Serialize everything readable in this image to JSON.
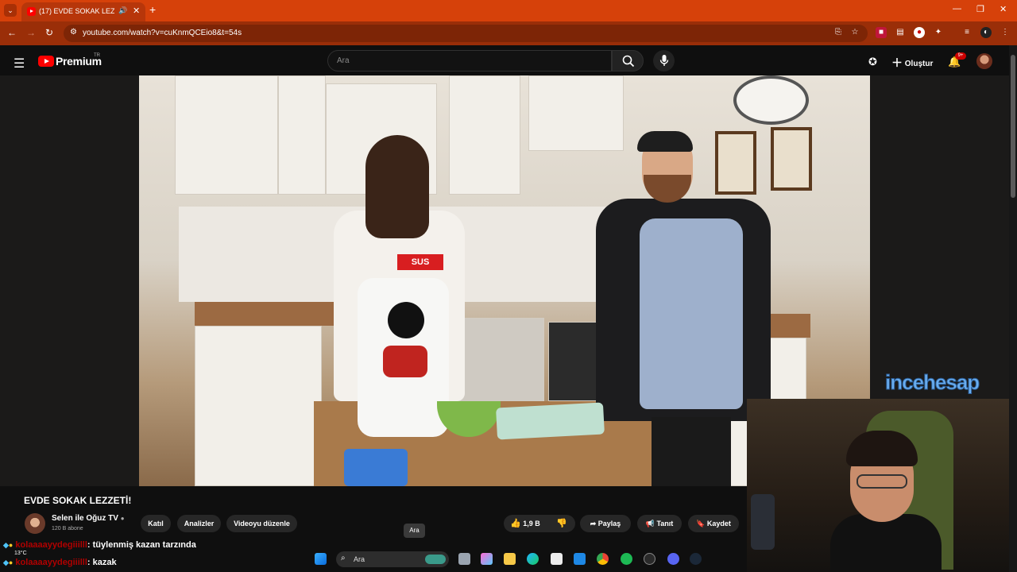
{
  "browser": {
    "tab_title": "(17) EVDE SOKAK LEZZETİ!",
    "url": "youtube.com/watch?v=cuKnmQCEio8&t=54s"
  },
  "youtube": {
    "logo_text": "Premium",
    "logo_region": "TR",
    "search_placeholder": "Ara",
    "create_label": "Oluştur",
    "notif_badge": "9+"
  },
  "video": {
    "title": "EVDE SOKAK LEZZETİ!",
    "apron_text": "SUS",
    "watermark": "incehesap"
  },
  "channel": {
    "name": "Selen ile Oğuz TV",
    "subs": "120 B abone"
  },
  "actions": {
    "join": "Katıl",
    "analytics": "Analizler",
    "edit": "Videoyu düzenle",
    "likes": "1,9 B",
    "share": "Paylaş",
    "promote": "Tanıt",
    "save": "Kaydet"
  },
  "chat": [
    {
      "user": "kolaaaayydegiiilll",
      "message": ": tüylenmiş kazan tarzında"
    },
    {
      "user": "kolaaaayydegiiilll",
      "message": ": kazak"
    }
  ],
  "taskbar": {
    "search_placeholder": "Ara",
    "tooltip": "Ara",
    "temperature": "13°C"
  },
  "colors": {
    "browser_accent": "#d6410a",
    "youtube_red": "#ff0000",
    "chat_username": "#b00000"
  }
}
